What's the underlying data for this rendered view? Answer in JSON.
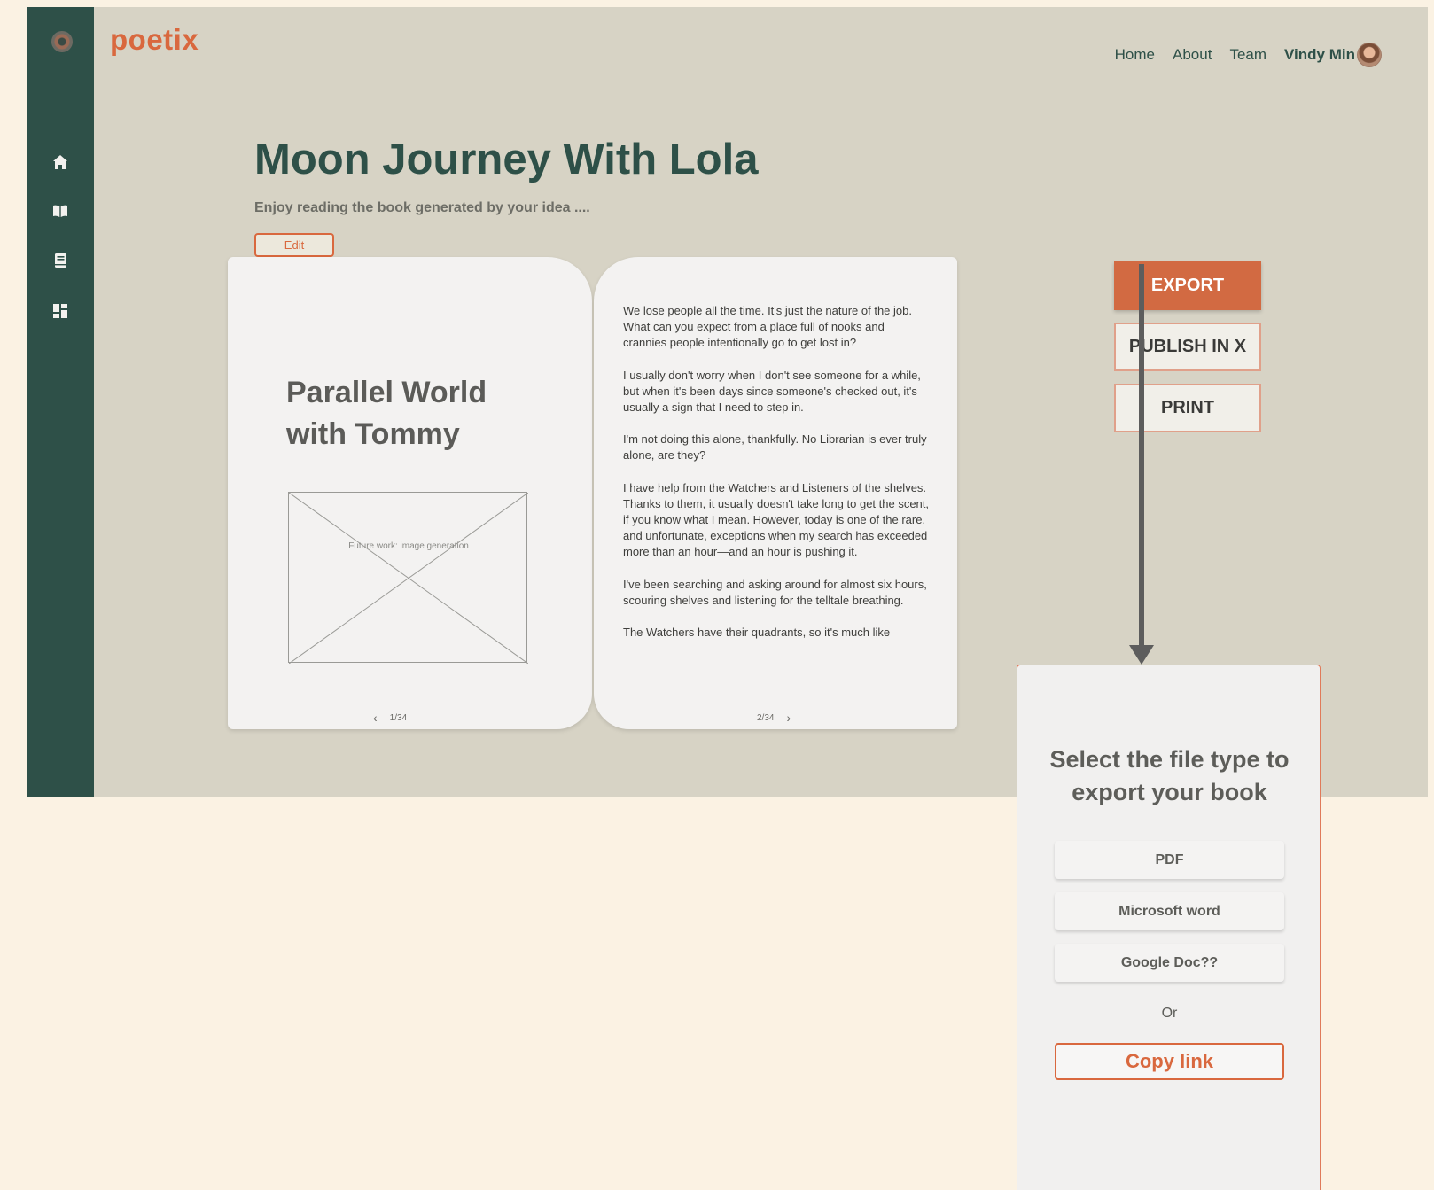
{
  "app": {
    "brand": "poetix"
  },
  "sidebar": {
    "items": [
      {
        "icon": "home-icon"
      },
      {
        "icon": "book-open-icon"
      },
      {
        "icon": "notebook-icon"
      },
      {
        "icon": "dashboard-icon"
      }
    ]
  },
  "nav": {
    "home": "Home",
    "about": "About",
    "team": "Team",
    "user": "Vindy Min"
  },
  "header": {
    "title": "Moon Journey With Lola",
    "subtitle": "Enjoy reading the book generated by your idea ....",
    "edit_label": "Edit"
  },
  "book": {
    "left_page": {
      "chapter_title": "Parallel World with Tommy",
      "image_placeholder": "Future work: image generation",
      "page_number": "1/34"
    },
    "right_page": {
      "paragraphs": [
        "We lose people all the time. It's just the nature of the job. What can you expect from a place full of nooks and crannies people intentionally go to get lost in?",
        "I usually don't worry when I don't see someone for a while, but when it's been days since someone's checked out, it's usually a sign that I need to step in.",
        "I'm not doing this alone, thankfully. No Librarian is ever truly alone, are they?",
        "I have help from the Watchers and Listeners of the shelves. Thanks to them, it usually doesn't take long to get the scent, if you know what I mean. However, today is one of the rare, and unfortunate, exceptions when my search has exceeded more than an hour—and an hour is pushing it.",
        "I've been searching and asking around for almost six hours, scouring shelves and listening for the telltale breathing.",
        "The Watchers have their quadrants, so it's much like"
      ],
      "page_number": "2/34"
    }
  },
  "actions": {
    "export": "EXPORT",
    "publish": "PUBLISH IN X",
    "print": "PRINT"
  },
  "export_panel": {
    "title": "Select the file type to export your book",
    "options": [
      "PDF",
      "Microsoft word",
      "Google Doc??"
    ],
    "or_text": "Or",
    "copy_link": "Copy link"
  },
  "colors": {
    "accent": "#d9683e",
    "sidebar": "#2e5048",
    "app_bg": "#d7d3c5",
    "page_bg": "#fbf2e3"
  }
}
